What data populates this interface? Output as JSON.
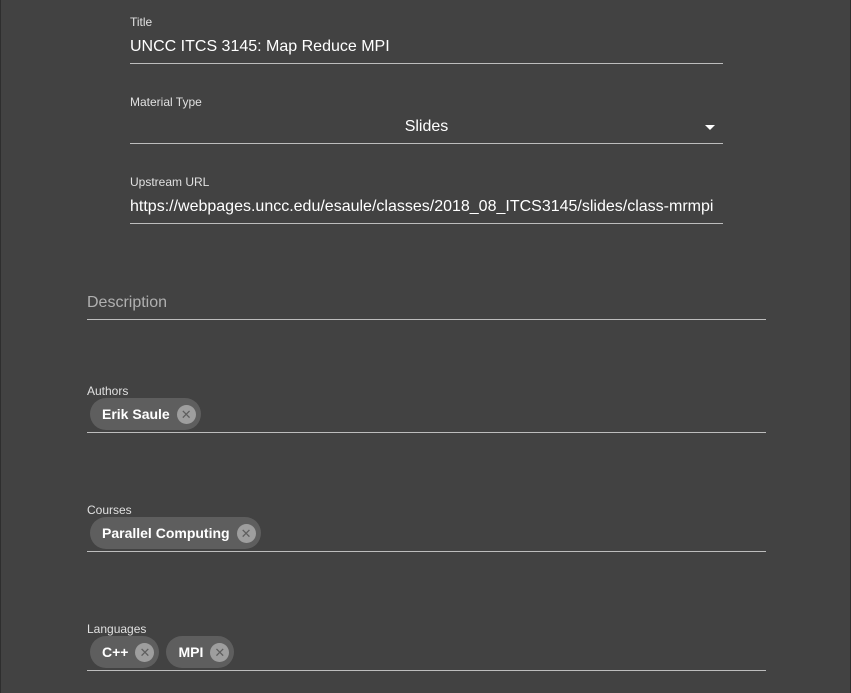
{
  "form": {
    "title": {
      "label": "Title",
      "value": "UNCC ITCS 3145: Map Reduce MPI"
    },
    "material_type": {
      "label": "Material Type",
      "value": "Slides",
      "icon": "caret-down-icon"
    },
    "upstream_url": {
      "label": "Upstream URL",
      "value": "https://webpages.uncc.edu/esaule/classes/2018_08_ITCS3145/slides/class-mrmpi"
    },
    "description": {
      "placeholder": "Description"
    },
    "authors": {
      "label": "Authors",
      "chips": [
        "Erik Saule"
      ]
    },
    "courses": {
      "label": "Courses",
      "chips": [
        "Parallel Computing"
      ]
    },
    "languages": {
      "label": "Languages",
      "chips": [
        "C++",
        "MPI"
      ]
    }
  },
  "colors": {
    "background": "#424242",
    "chip": "#5e5e5e",
    "chip_remove": "#9e9e9e",
    "underline": "#bdbdbd"
  },
  "icons": {
    "chip_remove": "close-circle-icon"
  }
}
